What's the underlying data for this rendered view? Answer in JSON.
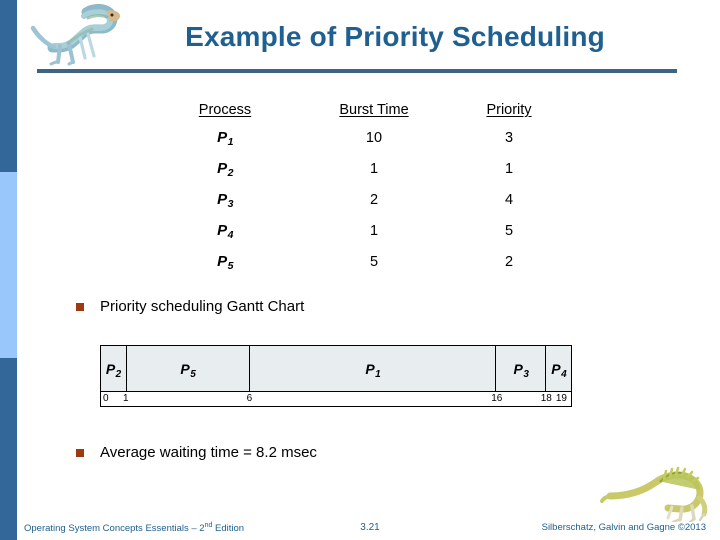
{
  "slide": {
    "title": "Example of Priority Scheduling",
    "logo_icon": "dinosaur-logo-icon",
    "footer_dino_icon": "dimetrodon-icon",
    "accent_color": "#1f6091",
    "sidebar_color": "#336699",
    "sidebar_accent_color": "#99c6fb",
    "bullet_color": "#9c3b12",
    "gantt_fill_color": "#e8eef0"
  },
  "table": {
    "headers": [
      "Process",
      "Burst Time",
      "Priority"
    ],
    "rows": [
      {
        "process": "P",
        "sub": "1",
        "burst": "10",
        "priority": "3"
      },
      {
        "process": "P",
        "sub": "2",
        "burst": "1",
        "priority": "1"
      },
      {
        "process": "P",
        "sub": "3",
        "burst": "2",
        "priority": "4"
      },
      {
        "process": "P",
        "sub": "4",
        "burst": "1",
        "priority": "5"
      },
      {
        "process": "P",
        "sub": "5",
        "burst": "5",
        "priority": "2"
      }
    ]
  },
  "bullets": {
    "gantt_label": "Priority scheduling Gantt Chart",
    "average_label": "Average waiting time = 8.2 msec"
  },
  "chart_data": {
    "type": "bar",
    "title": "Priority scheduling Gantt Chart",
    "xlabel": "",
    "ylabel": "",
    "xlim": [
      0,
      19
    ],
    "grid": false,
    "legend": "none",
    "segments": [
      {
        "label": "P",
        "sub": "2",
        "start": 0,
        "end": 1
      },
      {
        "label": "P",
        "sub": "5",
        "start": 1,
        "end": 6
      },
      {
        "label": "P",
        "sub": "1",
        "start": 6,
        "end": 16
      },
      {
        "label": "P",
        "sub": "3",
        "start": 16,
        "end": 18
      },
      {
        "label": "P",
        "sub": "4",
        "start": 18,
        "end": 19
      }
    ],
    "tick_labels": [
      "0",
      "1",
      "6",
      "16",
      "18",
      "19"
    ],
    "tick_values": [
      0,
      1,
      6,
      16,
      18,
      19
    ]
  },
  "footer": {
    "left_text": "Operating System Concepts Essentials – 2",
    "left_sup": "nd",
    "left_tail": " Edition",
    "slide_number": "3.21",
    "right_text": "Silberschatz, Galvin and Gagne ©2013"
  }
}
